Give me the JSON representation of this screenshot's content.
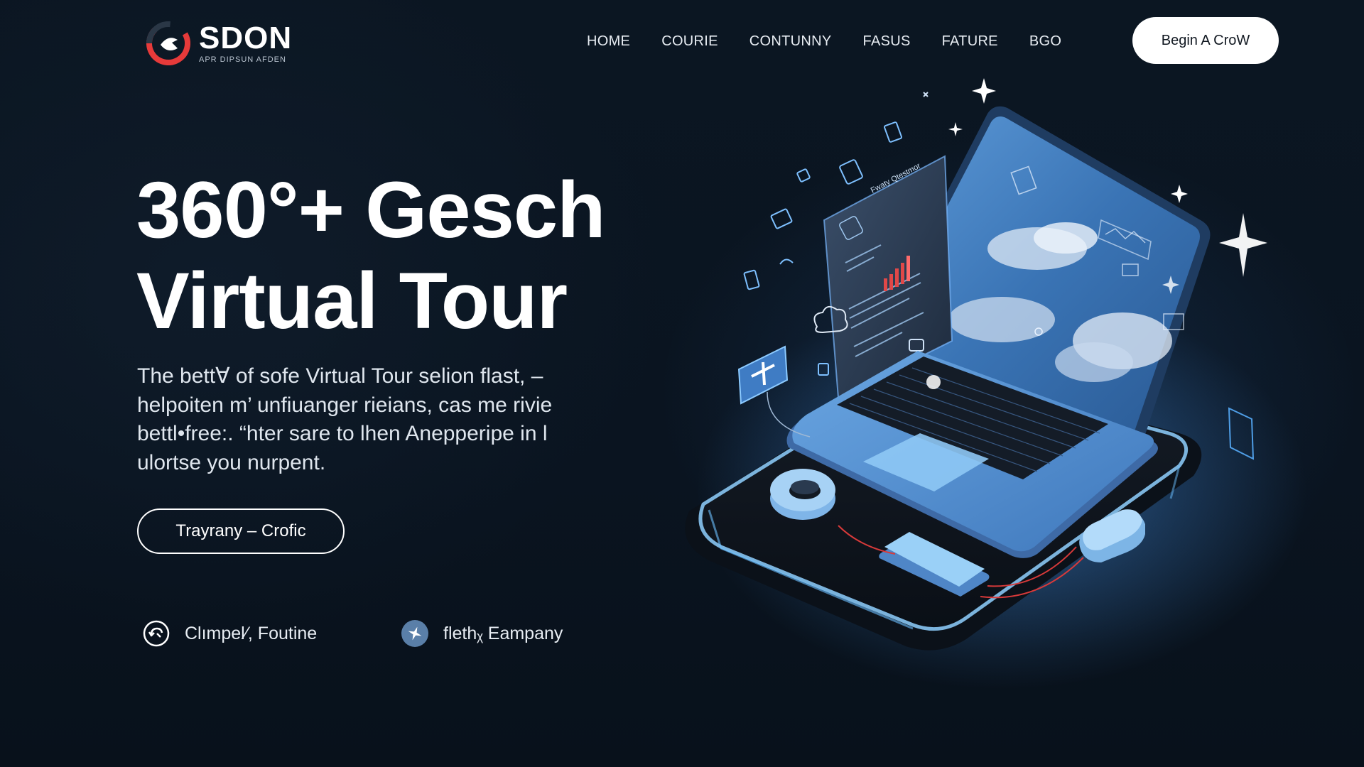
{
  "brand": {
    "name": "SDON",
    "tagline": "APR DIPSUN AFDEN",
    "colors": {
      "accent": "#e63a3a",
      "background": "#0a1420",
      "glow": "#4fa3ff"
    }
  },
  "nav": {
    "items": [
      "HOME",
      "COURIE",
      "CONTUNNY",
      "FASUS",
      "FATURE",
      "BGO"
    ],
    "cta_label": "Begin A CroW"
  },
  "hero": {
    "title_lines": [
      "360°+ Gesch",
      "Virtual Tour"
    ],
    "description_lines": [
      "The bettⱯ of sofe Virtual Tour selion flast, –",
      "helpoiten m’ unfiuanger rieians, cas me rivie",
      "bettl•free:. “hter sare to lhen Anepperipe in l",
      "ulortse you nurpent."
    ],
    "secondary_cta_label": "Trayrany – Crofic"
  },
  "features": [
    {
      "label": "Clımpel⁄, Foutine",
      "icon": "refresh-arrow-icon"
    },
    {
      "label": "flethᵪ Eampany",
      "icon": "compass-star-icon"
    }
  ],
  "illustration": {
    "panel_title": "Fwaty Qtestmor",
    "icons": [
      "laptop-icon",
      "smartphone-icon",
      "mouse-icon",
      "speaker-icon",
      "plus-icon",
      "cloud-icon",
      "sparkle-icon"
    ]
  }
}
